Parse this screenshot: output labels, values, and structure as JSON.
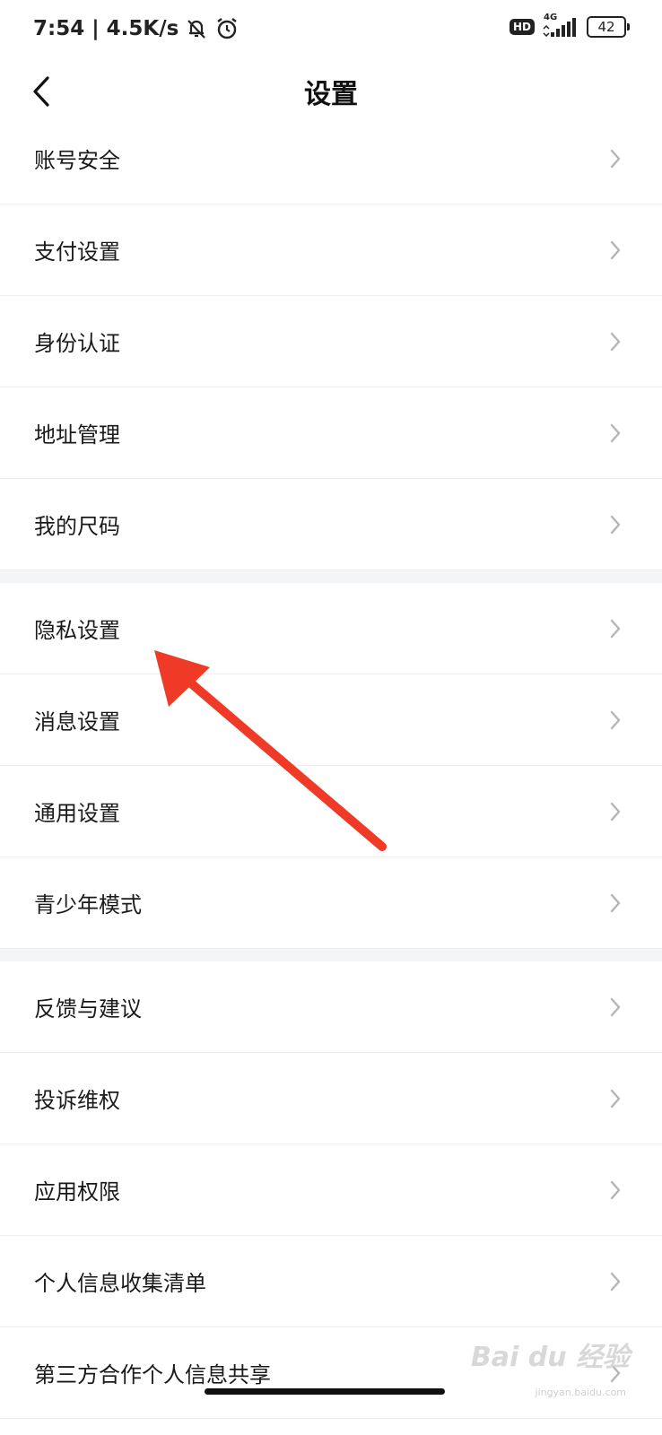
{
  "status": {
    "time": "7:54",
    "separator": "|",
    "speed": "4.5K/s",
    "hd": "HD",
    "network": "4G",
    "battery": "42"
  },
  "nav": {
    "title": "设置"
  },
  "groups": [
    [
      "账号安全",
      "支付设置",
      "身份认证",
      "地址管理",
      "我的尺码"
    ],
    [
      "隐私设置",
      "消息设置",
      "通用设置",
      "青少年模式"
    ],
    [
      "反馈与建议",
      "投诉维权",
      "应用权限",
      "个人信息收集清单",
      "第三方合作个人信息共享"
    ]
  ],
  "watermark": {
    "text": "Bai du 经验",
    "url": "jingyan.baidu.com"
  },
  "colors": {
    "annotation_arrow": "#f03a28",
    "chevron": "#b5b5b5",
    "section_gap": "#f4f5f7"
  }
}
